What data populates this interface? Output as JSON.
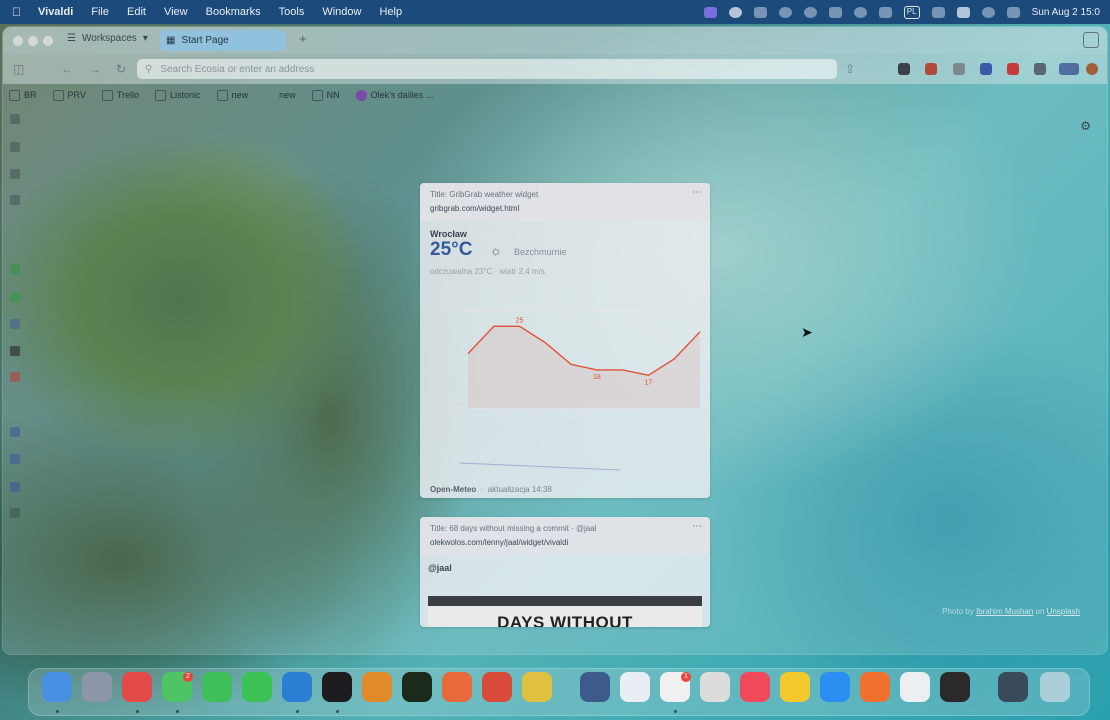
{
  "menubar": {
    "app": "Vivaldi",
    "items": [
      "File",
      "Edit",
      "View",
      "Bookmarks",
      "Tools",
      "Window",
      "Help"
    ],
    "language": "PL",
    "clock": "Sun Aug 2  15:0"
  },
  "browser": {
    "workspaces_label": "Workspaces",
    "active_tab": "Start Page",
    "address_placeholder": "Search Ecosia or enter an address",
    "bookmarks": [
      "BR",
      "PRV",
      "Trello",
      "Listonic",
      "new",
      "new",
      "NN",
      "Olek's dailies ..."
    ]
  },
  "weather_widget": {
    "title": "Title: GribGrab weather widget",
    "url": "gribgrab.com/widget.html",
    "city": "Wrocław",
    "temp": "25°C",
    "condition": "Bezchmurnie",
    "feels": "odczuwalna 23°C · wiatr 2.4 m/s",
    "source": "Open-Meteo",
    "updated": "aktualizacja 14:38"
  },
  "commit_widget": {
    "title": "Title: 68 days without missing a commit · @jaal",
    "url": "olekwolos.com/lenny/jaal/widget/vivaldi",
    "handle": "@jaal",
    "banner_text": "DAYS WITHOUT"
  },
  "credit": {
    "prefix": "Photo by ",
    "author": "Ibrahim Mushan",
    "mid": " on ",
    "site": "Unsplash"
  },
  "chart_data": {
    "type": "line",
    "series": [
      {
        "values": [
          20,
          25,
          25,
          22,
          18,
          17,
          17,
          16,
          19,
          24
        ]
      }
    ],
    "labels": [
      "25",
      "18",
      "17"
    ],
    "ylim": [
      10,
      28
    ]
  },
  "colors": {
    "menubar": "#1c4a7a",
    "tab_active": "#8cc3e6",
    "chart_line": "#e0503a"
  }
}
